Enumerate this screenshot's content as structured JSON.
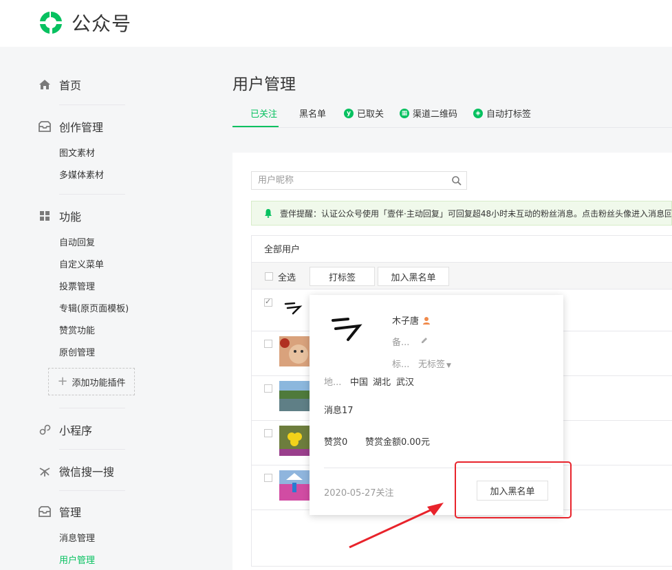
{
  "brand": {
    "name": "公众号",
    "accent": "#07c160"
  },
  "sidebar": {
    "groups": [
      {
        "label": "首页",
        "icon": "home-icon",
        "items": []
      },
      {
        "label": "创作管理",
        "icon": "inbox-icon",
        "items": [
          "图文素材",
          "多媒体素材"
        ]
      },
      {
        "label": "功能",
        "icon": "grid-icon",
        "items": [
          "自动回复",
          "自定义菜单",
          "投票管理",
          "专辑(原页面模板)",
          "赞赏功能",
          "原创管理"
        ],
        "add_plugin": "添加功能插件"
      },
      {
        "label": "小程序",
        "icon": "link-icon",
        "items": []
      },
      {
        "label": "微信搜一搜",
        "icon": "sparkle-icon",
        "items": []
      },
      {
        "label": "管理",
        "icon": "inbox-icon",
        "items": [
          "消息管理",
          "用户管理"
        ],
        "active_item": "用户管理"
      }
    ]
  },
  "page": {
    "title": "用户管理"
  },
  "tabs": [
    {
      "label": "已关注",
      "active": true
    },
    {
      "label": "黑名单"
    },
    {
      "label": "已取关",
      "icon": "y"
    },
    {
      "label": "渠道二维码",
      "icon": "qr"
    },
    {
      "label": "自动打标签",
      "icon": "tag"
    }
  ],
  "search": {
    "placeholder": "用户昵称"
  },
  "tip": {
    "text": "壹伴提醒：认证公众号使用「壹伴·主动回复」可回复超48小时未互动的粉丝消息。点击粉丝头像进入消息回"
  },
  "table": {
    "header": "全部用户",
    "toolbar": {
      "select_all": "全选",
      "tag_button": "打标签",
      "blacklist_button": "加入黑名单"
    },
    "rows": [
      {
        "checked": true,
        "avatar": "scribble"
      },
      {
        "checked": false,
        "avatar": "cat"
      },
      {
        "checked": false,
        "avatar": "lake"
      },
      {
        "checked": false,
        "avatar": "flower"
      },
      {
        "checked": false,
        "avatar": "field"
      }
    ]
  },
  "popup": {
    "name": "木子唐",
    "remark_label": "备...",
    "tag_label": "标...",
    "tag_value": "无标签",
    "region_label": "地...",
    "country": "中国",
    "province": "湖北",
    "city": "武汉",
    "messages": "消息17",
    "rewards": "赞赏0",
    "reward_amount": "赞赏金额0.00元",
    "follow_date": "2020-05-27关注",
    "blacklist_button": "加入黑名单"
  },
  "annotation": {
    "color": "#e8232b"
  }
}
